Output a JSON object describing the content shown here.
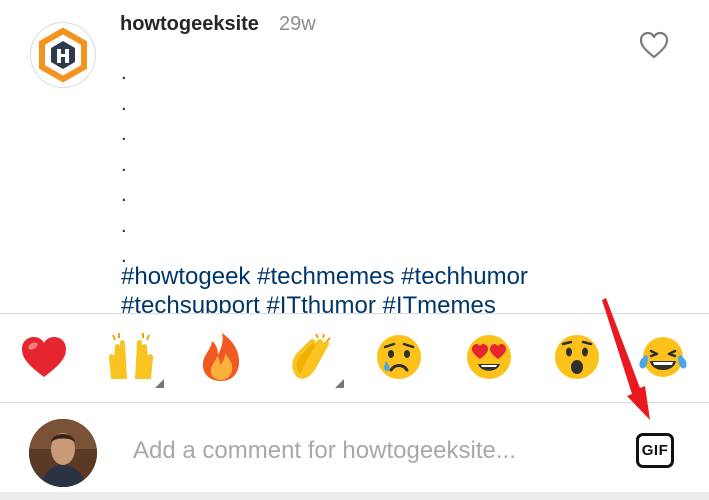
{
  "post": {
    "username": "howtogeeksite",
    "time_ago": "29w",
    "caption_dots": [
      ".",
      ".",
      ".",
      ".",
      ".",
      ".",
      "."
    ],
    "hashtags_line1": [
      "#howtogeek",
      "#techmemes",
      "#techhumor"
    ],
    "hashtags_line2": [
      "#techsupport",
      "#ITthumor",
      "#ITmemes"
    ]
  },
  "reactions": [
    {
      "name": "red-heart",
      "glyph": "❤️"
    },
    {
      "name": "raising-hands",
      "glyph": "🙌"
    },
    {
      "name": "fire",
      "glyph": "🔥"
    },
    {
      "name": "clapping-hands",
      "glyph": "👏"
    },
    {
      "name": "crying-face",
      "glyph": "😢"
    },
    {
      "name": "heart-eyes",
      "glyph": "😍"
    },
    {
      "name": "surprised-face",
      "glyph": "😮"
    },
    {
      "name": "tears-of-joy",
      "glyph": "😂"
    }
  ],
  "composer": {
    "placeholder": "Add a comment for howtogeeksite...",
    "gif_label": "GIF"
  },
  "colors": {
    "hashtag": "#00376b",
    "arrow": "#e8191f",
    "brand_orange": "#f29420",
    "brand_navy": "#2e3a4a"
  }
}
